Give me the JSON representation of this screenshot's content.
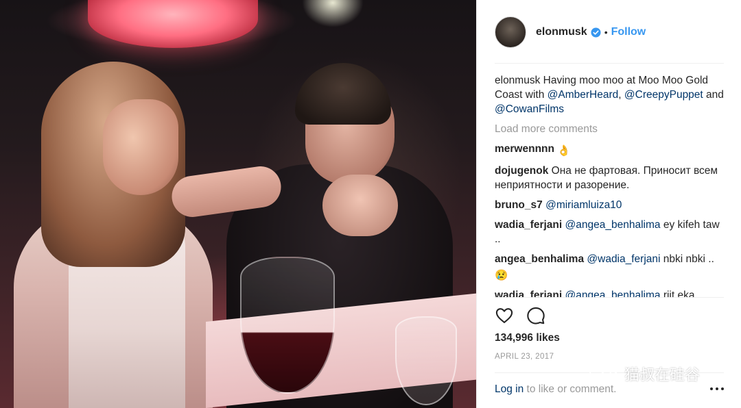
{
  "post": {
    "author": "elonmusk",
    "follow_label": "Follow",
    "dot": "•"
  },
  "comments": {
    "caption": {
      "user": "elonmusk",
      "text_before": " Having moo moo at Moo Moo Gold Coast with ",
      "mention1": "@AmberHeard",
      "sep": ", ",
      "mention2": "@CreepyPuppet",
      "and": " and ",
      "mention3": "@CowanFilms"
    },
    "load_more": "Load more comments",
    "items": [
      {
        "user": "merwennnn",
        "emoji": "👌"
      },
      {
        "user": "dojugenok",
        "text": " Она не фартовая. Приносит всем неприятности и разорение."
      },
      {
        "user": "bruno_s7",
        "mention": "@miriamluiza10"
      },
      {
        "user": "wadia_ferjani",
        "mention": "@angea_benhalima",
        "text": " ey kifeh taw .."
      },
      {
        "user": "angea_benhalima",
        "mention": "@wadia_ferjani",
        "text": " nbki nbki .. ",
        "emoji": "😢"
      },
      {
        "user": "wadia_ferjani",
        "mention": "@angea_benhalima",
        "text": " riit eka"
      }
    ]
  },
  "likes": "134,996 likes",
  "date": "APRIL 23, 2017",
  "login": {
    "link": "Log in",
    "rest": " to like or comment."
  },
  "watermark": "猫叔在硅谷",
  "colors": {
    "link_blue": "#3897f0",
    "mention_blue": "#003569",
    "muted_gray": "#999999",
    "text": "#262626"
  },
  "icons": {
    "verified": "verified-badge-icon",
    "like": "heart-icon",
    "comment": "comment-bubble-icon",
    "more": "more-options-icon",
    "watermark": "wechat-icon"
  }
}
